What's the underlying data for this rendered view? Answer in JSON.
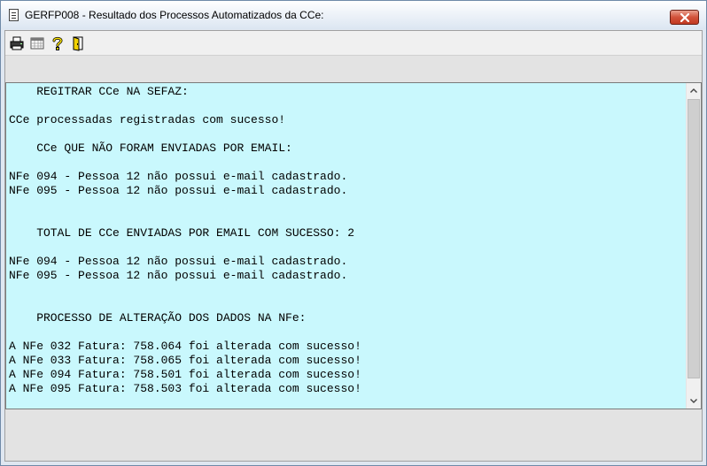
{
  "window": {
    "title": "GERFP008 - Resultado dos Processos Automatizados da CCe:"
  },
  "toolbar": {
    "buttons": [
      {
        "icon": "printer-icon"
      },
      {
        "icon": "calendar-icon"
      },
      {
        "icon": "help-icon"
      },
      {
        "icon": "exit-door-icon"
      }
    ]
  },
  "result_text": {
    "lines": [
      "    REGITRAR CCe NA SEFAZ:",
      "",
      "CCe processadas registradas com sucesso!",
      "",
      "    CCe QUE NÃO FORAM ENVIADAS POR EMAIL:",
      "",
      "NFe 094 - Pessoa 12 não possui e-mail cadastrado.",
      "NFe 095 - Pessoa 12 não possui e-mail cadastrado.",
      "",
      "",
      "    TOTAL DE CCe ENVIADAS POR EMAIL COM SUCESSO: 2",
      "",
      "NFe 094 - Pessoa 12 não possui e-mail cadastrado.",
      "NFe 095 - Pessoa 12 não possui e-mail cadastrado.",
      "",
      "",
      "    PROCESSO DE ALTERAÇÃO DOS DADOS NA NFe:",
      "",
      "A NFe 032 Fatura: 758.064 foi alterada com sucesso!",
      "A NFe 033 Fatura: 758.065 foi alterada com sucesso!",
      "A NFe 094 Fatura: 758.501 foi alterada com sucesso!",
      "A NFe 095 Fatura: 758.503 foi alterada com sucesso!"
    ]
  },
  "colors": {
    "text_area_background": "#c9f8fd",
    "close_button": "#c94a34"
  }
}
